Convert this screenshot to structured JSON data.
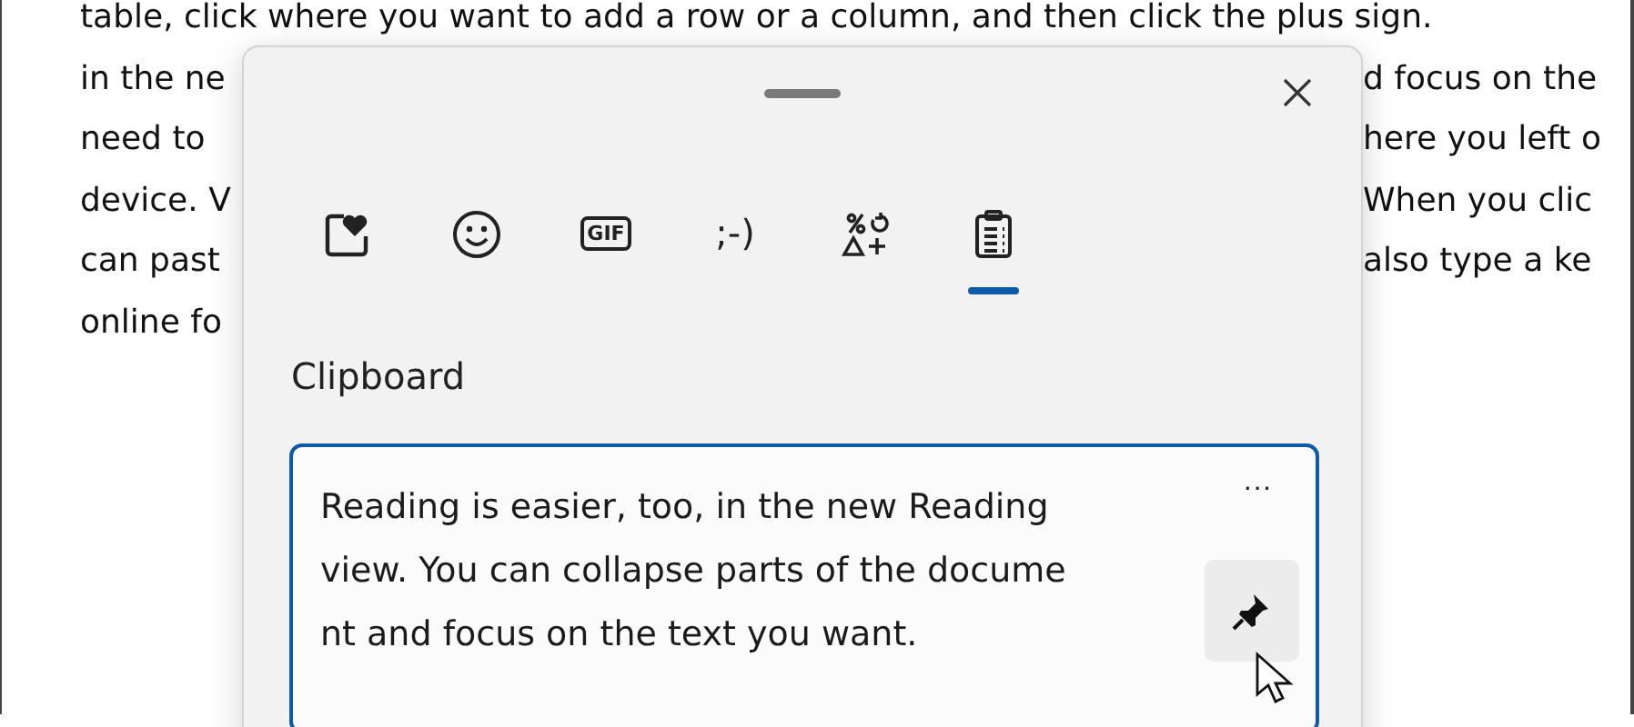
{
  "document": {
    "lines": [
      {
        "left": "table, click where you want to add a row or a column, and then click the plus sign."
      },
      {
        "left": "in the ne",
        "right": "d focus on the"
      },
      {
        "left": "need to",
        "right": "here you left o"
      },
      {
        "left": "device. V",
        "right": "When you clic"
      },
      {
        "left": "can past",
        "right": "also type a ke"
      },
      {
        "left": "online fo"
      }
    ]
  },
  "panel": {
    "tabs": [
      {
        "kind": "favorites",
        "selected": false
      },
      {
        "kind": "emoji",
        "selected": false
      },
      {
        "kind": "gif",
        "label": "GIF",
        "selected": false
      },
      {
        "kind": "kaomoji",
        "label": ";-)",
        "selected": false
      },
      {
        "kind": "symbols",
        "selected": false
      },
      {
        "kind": "clipboard",
        "selected": true
      }
    ],
    "section_title": "Clipboard",
    "clip_items": [
      {
        "lines": [
          "Reading is easier, too, in the new Reading",
          "view. You can collapse parts of the docume",
          "nt and focus on the text you want."
        ],
        "more": "···",
        "selected": true
      }
    ]
  }
}
